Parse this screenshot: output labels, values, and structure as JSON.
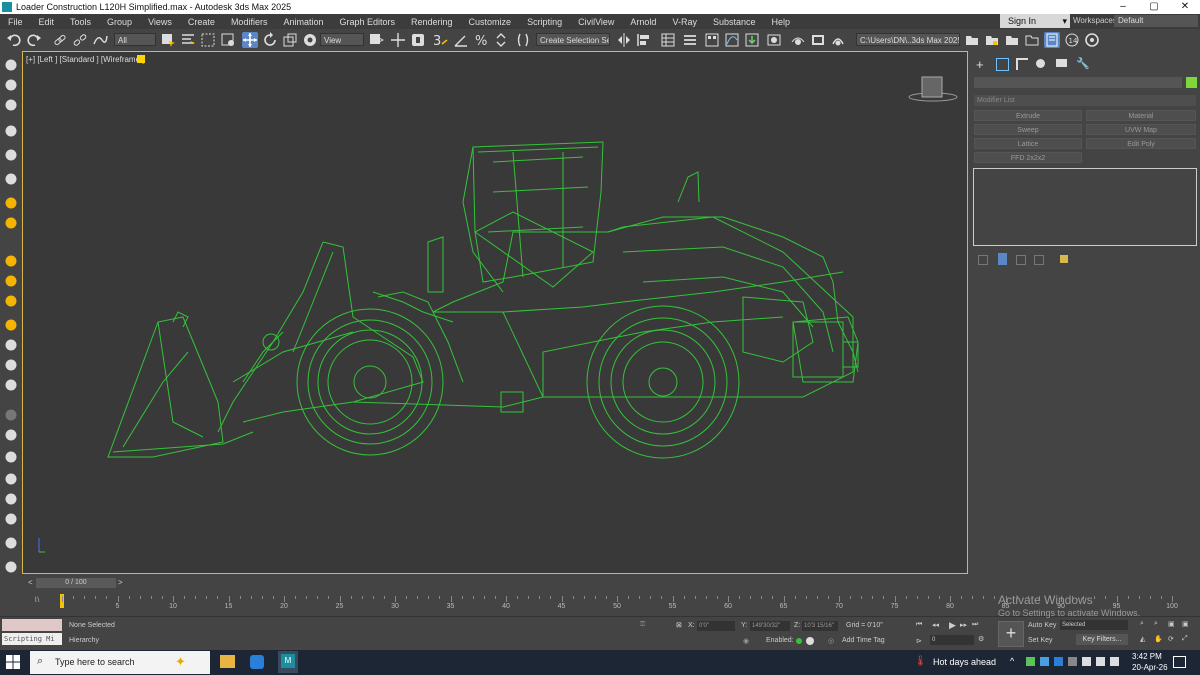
{
  "window": {
    "title": "Loader Construction L120H Simplified.max - Autodesk 3ds Max 2025",
    "minimize": "–",
    "maximize": "▢",
    "close": "✕"
  },
  "menu": [
    "File",
    "Edit",
    "Tools",
    "Group",
    "Views",
    "Create",
    "Modifiers",
    "Animation",
    "Graph Editors",
    "Rendering",
    "Customize",
    "Scripting",
    "CivilView",
    "Arnold",
    "V-Ray",
    "Substance",
    "Help"
  ],
  "signin": {
    "label": "Sign In",
    "arrow": "▾"
  },
  "workspace": {
    "label": "Workspaces:",
    "value": "Default"
  },
  "toolbar": {
    "filter": "All",
    "refcoord": "View",
    "selection_set": "Create Selection Se",
    "project_path": "C:\\Users\\DN\\..3ds Max 2025",
    "snap_num": "3",
    "spinner_pct": "%"
  },
  "viewport": {
    "label": "[+] [Left ] [Standard ] [Wireframe ]",
    "accent": "#ffd400",
    "wire_color": "#35c23a"
  },
  "command_panel": {
    "modifier_list": "Modifier List",
    "buttons": [
      "Extrude",
      "Material",
      "Sweep",
      "UVW Map",
      "Lattice",
      "Edit Poly",
      "FFD 2x2x2"
    ],
    "swatch_color": "#7fd63a"
  },
  "timeline": {
    "slider": "0 / 100",
    "prev": "<",
    "next": ">",
    "ticks": [
      0,
      5,
      10,
      15,
      20,
      25,
      30,
      35,
      40,
      45,
      50,
      55,
      60,
      65,
      70,
      75,
      80,
      85,
      90,
      95,
      100
    ]
  },
  "status": {
    "maxscript": "Scripting Mi",
    "selection": "None Selected",
    "hierarchy": "Hierarchy",
    "x_label": "X:",
    "x_value": "0'0\"",
    "y_label": "Y:",
    "y_value": "149'30/32\"",
    "z_label": "Z:",
    "z_value": "10'3 15/16\"",
    "grid": "Grid = 0'10\"",
    "enabled": "Enabled:",
    "add_time_tag": "Add Time Tag",
    "auto_key": "Auto Key",
    "selected": "Selected",
    "set_key": "Set Key",
    "key_filters": "Key Filters...",
    "frame": "0",
    "activate_title": "Activate Windows",
    "activate_sub": "Go to Settings to activate Windows."
  },
  "taskbar": {
    "search": "Type here to search",
    "weather": "Hot days ahead",
    "time": "3:42 PM",
    "date": "20-Apr-26",
    "app_badge": "M"
  }
}
